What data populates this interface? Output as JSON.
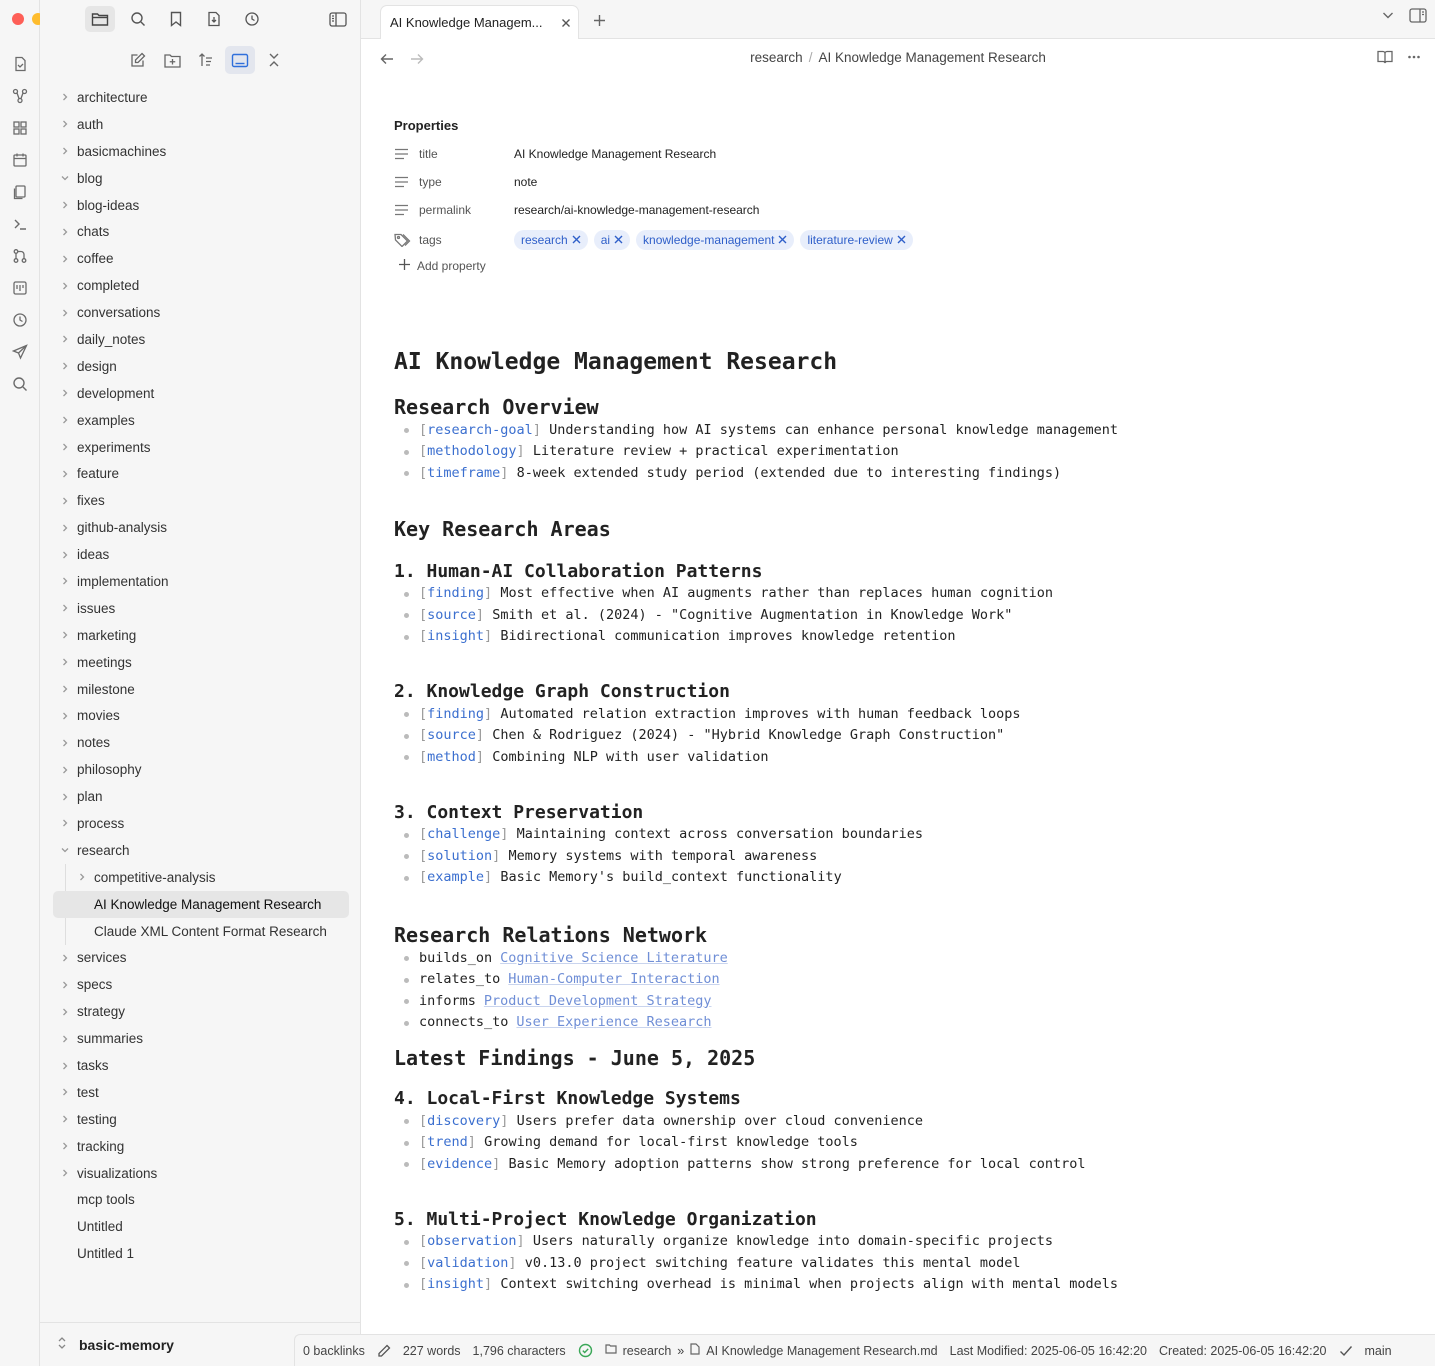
{
  "colors": {
    "traffic_red": "#fe5f57",
    "traffic_yellow": "#febc2e",
    "traffic_green": "#28c840",
    "accent": "#3b6fcf",
    "sync_ok": "#3aa757"
  },
  "tab": {
    "title": "AI Knowledge Managem..."
  },
  "breadcrumb": {
    "folder": "research",
    "separator": "/",
    "note": "AI Knowledge Management Research"
  },
  "tree": {
    "folders_top": [
      "architecture",
      "auth",
      "basicmachines"
    ],
    "blog": "blog",
    "folders_mid": [
      "blog-ideas",
      "chats",
      "coffee",
      "completed",
      "conversations",
      "daily_notes",
      "design",
      "development",
      "examples",
      "experiments",
      "feature",
      "fixes",
      "github-analysis",
      "ideas",
      "implementation",
      "issues",
      "marketing",
      "meetings",
      "milestone",
      "movies",
      "notes",
      "philosophy",
      "plan",
      "process"
    ],
    "research": "research",
    "research_children": {
      "subfolder": "competitive-analysis",
      "files": [
        "AI Knowledge Management Research",
        "Claude XML Content Format Research"
      ]
    },
    "folders_bottom": [
      "services",
      "specs",
      "strategy",
      "summaries",
      "tasks",
      "test",
      "testing",
      "tracking",
      "visualizations"
    ],
    "files": [
      "mcp tools",
      "Untitled",
      "Untitled 1"
    ]
  },
  "vault": {
    "name": "basic-memory"
  },
  "properties": {
    "heading": "Properties",
    "title_key": "title",
    "title_val": "AI Knowledge Management Research",
    "type_key": "type",
    "type_val": "note",
    "permalink_key": "permalink",
    "permalink_val": "research/ai-knowledge-management-research",
    "tags_key": "tags",
    "tags": [
      "research",
      "ai",
      "knowledge-management",
      "literature-review"
    ],
    "add": "Add property"
  },
  "doc": {
    "h1": "AI Knowledge Management Research",
    "overview": {
      "heading": "Research Overview",
      "items": [
        {
          "cat": "research-goal",
          "text": "Understanding how AI systems can enhance personal knowledge management"
        },
        {
          "cat": "methodology",
          "text": "Literature review + practical experimentation"
        },
        {
          "cat": "timeframe",
          "text": "8-week extended study period (extended due to interesting findings)"
        }
      ]
    },
    "key_areas": "Key Research Areas",
    "s1": {
      "heading": "1. Human-AI Collaboration Patterns",
      "items": [
        {
          "cat": "finding",
          "text": "Most effective when AI augments rather than replaces human cognition"
        },
        {
          "cat": "source",
          "text": "Smith et al. (2024) - \"Cognitive Augmentation in Knowledge Work\""
        },
        {
          "cat": "insight",
          "text": "Bidirectional communication improves knowledge retention"
        }
      ]
    },
    "s2": {
      "heading": "2. Knowledge Graph Construction",
      "items": [
        {
          "cat": "finding",
          "text": "Automated relation extraction improves with human feedback loops"
        },
        {
          "cat": "source",
          "text": "Chen & Rodriguez (2024) - \"Hybrid Knowledge Graph Construction\""
        },
        {
          "cat": "method",
          "text": "Combining NLP with user validation"
        }
      ]
    },
    "s3": {
      "heading": "3. Context Preservation",
      "items": [
        {
          "cat": "challenge",
          "text": "Maintaining context across conversation boundaries"
        },
        {
          "cat": "solution",
          "text": "Memory systems with temporal awareness"
        },
        {
          "cat": "example",
          "text": "Basic Memory's build_context functionality"
        }
      ]
    },
    "relations": {
      "heading": "Research Relations Network",
      "items": [
        {
          "rel": "builds_on",
          "link": "Cognitive Science Literature"
        },
        {
          "rel": "relates_to",
          "link": "Human-Computer Interaction"
        },
        {
          "rel": "informs",
          "link": "Product Development Strategy"
        },
        {
          "rel": "connects_to",
          "link": "User Experience Research"
        }
      ]
    },
    "latest": "Latest Findings - June 5, 2025",
    "s4": {
      "heading": "4. Local-First Knowledge Systems",
      "items": [
        {
          "cat": "discovery",
          "text": "Users prefer data ownership over cloud convenience"
        },
        {
          "cat": "trend",
          "text": "Growing demand for local-first knowledge tools"
        },
        {
          "cat": "evidence",
          "text": "Basic Memory adoption patterns show strong preference for local control"
        }
      ]
    },
    "s5": {
      "heading": "5. Multi-Project Knowledge Organization",
      "items": [
        {
          "cat": "observation",
          "text": "Users naturally organize knowledge into domain-specific projects"
        },
        {
          "cat": "validation",
          "text": "v0.13.0 project switching feature validates this mental model"
        },
        {
          "cat": "insight",
          "text": "Context switching overhead is minimal when projects align with mental models"
        }
      ]
    }
  },
  "status": {
    "backlinks": "0 backlinks",
    "words": "227 words",
    "chars": "1,796 characters",
    "path_folder": "research",
    "path_arrow": "»",
    "path_file": "AI Knowledge Management Research.md",
    "modified": "Last Modified: 2025-06-05 16:42:20",
    "created": "Created: 2025-06-05 16:42:20",
    "branch": "main"
  }
}
